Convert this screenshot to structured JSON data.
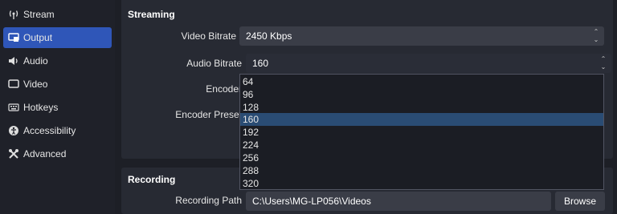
{
  "sidebar": {
    "items": [
      {
        "label": "Stream",
        "icon": "antenna-icon"
      },
      {
        "label": "Output",
        "icon": "output-icon"
      },
      {
        "label": "Audio",
        "icon": "speaker-icon"
      },
      {
        "label": "Video",
        "icon": "monitor-icon"
      },
      {
        "label": "Hotkeys",
        "icon": "keyboard-icon"
      },
      {
        "label": "Accessibility",
        "icon": "accessibility-icon"
      },
      {
        "label": "Advanced",
        "icon": "tools-icon"
      }
    ],
    "active": "Output",
    "accent_color": "#2f56b8"
  },
  "streaming": {
    "title": "Streaming",
    "video_bitrate_label": "Video Bitrate",
    "video_bitrate_value": "2450 Kbps",
    "audio_bitrate_label": "Audio Bitrate",
    "audio_bitrate_value": "160",
    "encoder_label": "Encoder",
    "encoder_preset_label": "Encoder Preset"
  },
  "audio_bitrate_dropdown": {
    "options": [
      "64",
      "96",
      "128",
      "160",
      "192",
      "224",
      "256",
      "288",
      "320"
    ],
    "selected": "160",
    "selected_color": "#2a4c74"
  },
  "recording": {
    "title": "Recording",
    "path_label": "Recording Path",
    "path_value": "C:\\Users\\MG-LP056\\Videos",
    "browse_label": "Browse"
  }
}
